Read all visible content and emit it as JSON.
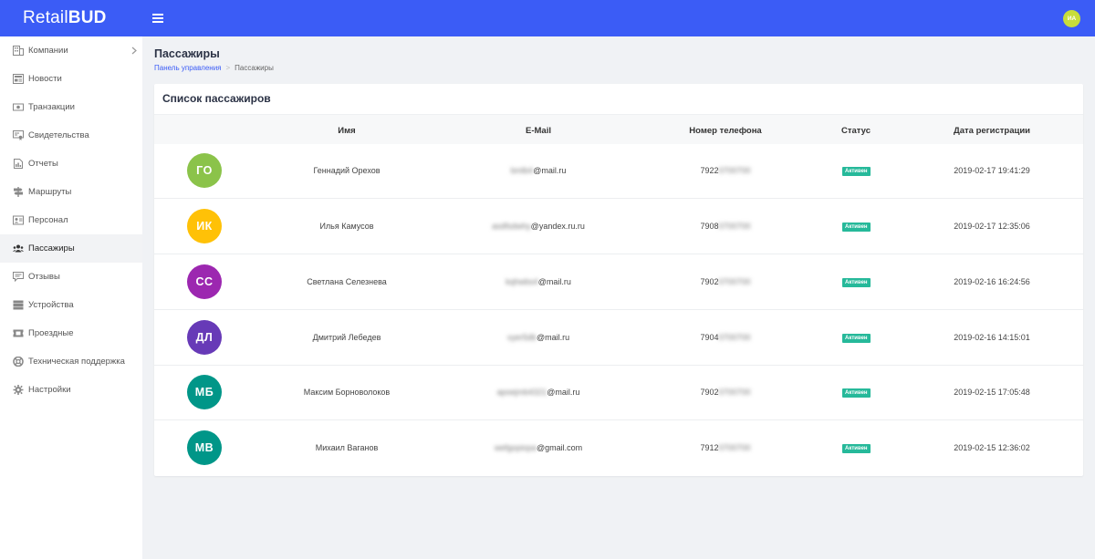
{
  "brand": {
    "logo_light": "Retail",
    "logo_bold": "BUD"
  },
  "user": {
    "initials": "ИА",
    "avatar_color": "#c8dd3a"
  },
  "colors": {
    "topbar": "#3b5cf6",
    "accent": "#3b5cf6",
    "status_active": "#26b99a"
  },
  "sidebar": {
    "items": [
      {
        "label": "Компании",
        "icon": "building-icon",
        "has_submenu": true
      },
      {
        "label": "Новости",
        "icon": "newspaper-icon"
      },
      {
        "label": "Транзакции",
        "icon": "money-icon"
      },
      {
        "label": "Свидетельства",
        "icon": "certificate-icon"
      },
      {
        "label": "Отчеты",
        "icon": "report-icon"
      },
      {
        "label": "Маршруты",
        "icon": "signpost-icon"
      },
      {
        "label": "Персонал",
        "icon": "id-card-icon"
      },
      {
        "label": "Пассажиры",
        "icon": "users-icon",
        "active": true
      },
      {
        "label": "Отзывы",
        "icon": "comments-icon"
      },
      {
        "label": "Устройства",
        "icon": "server-icon"
      },
      {
        "label": "Проездные",
        "icon": "ticket-icon"
      },
      {
        "label": "Техническая поддержка",
        "icon": "lifebuoy-icon"
      },
      {
        "label": "Настройки",
        "icon": "gear-icon"
      }
    ]
  },
  "page": {
    "title": "Пассажиры",
    "breadcrumb": {
      "link": "Панель управления",
      "current": "Пассажиры"
    }
  },
  "table": {
    "title": "Список пассажиров",
    "headers": {
      "name": "Имя",
      "email": "E-Mail",
      "phone": "Номер телефона",
      "status": "Статус",
      "date": "Дата регистрации"
    },
    "rows": [
      {
        "initials": "ГО",
        "avatar_color": "#8bc34a",
        "name": "Геннадий Орехов",
        "email_hidden": "bmlb4",
        "email_domain": "@mail.ru",
        "phone_prefix": "7922",
        "phone_hidden": "0700700",
        "status": "Активен",
        "date": "2019-02-17 19:41:29"
      },
      {
        "initials": "ИК",
        "avatar_color": "#ffc107",
        "name": "Илья Камусов",
        "email_hidden": "asdfsdwhy",
        "email_domain": "@yandex.ru.ru",
        "phone_prefix": "7908",
        "phone_hidden": "0700700",
        "status": "Активен",
        "date": "2019-02-17 12:35:06"
      },
      {
        "initials": "СС",
        "avatar_color": "#9c27b0",
        "name": "Светлана Селезнева",
        "email_hidden": "kqhwbs4",
        "email_domain": "@mail.ru",
        "phone_prefix": "7902",
        "phone_hidden": "0700700",
        "status": "Активен",
        "date": "2019-02-16 16:24:56"
      },
      {
        "initials": "ДЛ",
        "avatar_color": "#673ab7",
        "name": "Дмитрий Лебедев",
        "email_hidden": "vyer5db",
        "email_domain": "@mail.ru",
        "phone_prefix": "7904",
        "phone_hidden": "0700700",
        "status": "Активен",
        "date": "2019-02-16 14:15:01"
      },
      {
        "initials": "МБ",
        "avatar_color": "#009688",
        "name": "Максим Борноволоков",
        "email_hidden": "apoejmb4321",
        "email_domain": "@mail.ru",
        "phone_prefix": "7902",
        "phone_hidden": "0700700",
        "status": "Активен",
        "date": "2019-02-15 17:05:48"
      },
      {
        "initials": "МВ",
        "avatar_color": "#009688",
        "name": "Михаил Ваганов",
        "email_hidden": "wefgopiopa",
        "email_domain": "@gmail.com",
        "phone_prefix": "7912",
        "phone_hidden": "0700700",
        "status": "Активен",
        "date": "2019-02-15 12:36:02"
      }
    ]
  }
}
